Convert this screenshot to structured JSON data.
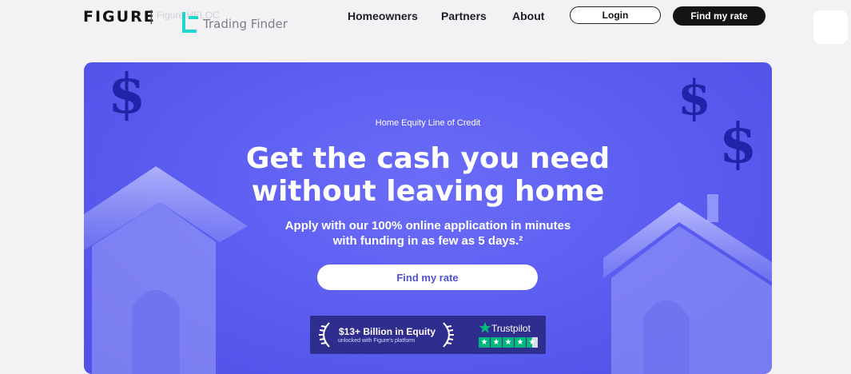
{
  "header": {
    "logo": "FIGURE",
    "logo_separator": "|",
    "brand_ghost": "Figure  HELOC",
    "watermark": "Trading Finder",
    "nav": [
      "Homeowners",
      "Partners",
      "About"
    ],
    "login_label": "Login",
    "cta_label": "Find my rate"
  },
  "hero": {
    "eyebrow": "Home Equity Line of Credit",
    "headline_line1": "Get the cash you need",
    "headline_line2": "without leaving home",
    "sub_line1": "Apply with our 100% online application in minutes",
    "sub_line2": "with funding in as few as 5 days.²",
    "cta_label": "Find my rate",
    "badge": {
      "title": "$13+ Billion in Equity",
      "subtitle": "unlocked with Figure's platform",
      "trustpilot": "Trustpilot",
      "rating_stars": 4.5
    }
  },
  "colors": {
    "hero_bg": "#5a5cf0",
    "accent": "#4e4fd9",
    "trustpilot_green": "#00b67a",
    "dark_button": "#141414"
  }
}
